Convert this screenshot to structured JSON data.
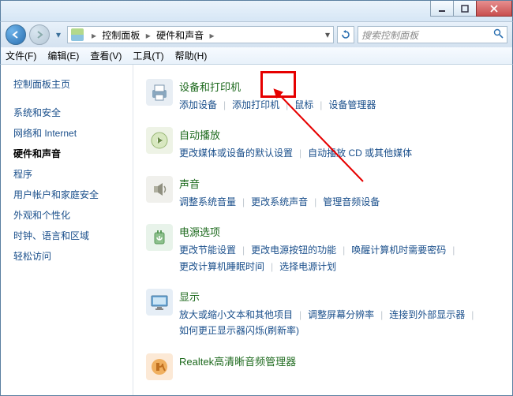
{
  "breadcrumb": {
    "root_icon_name": "control-panel-icon",
    "parts": [
      "控制面板",
      "硬件和声音"
    ]
  },
  "search": {
    "placeholder": "搜索控制面板"
  },
  "menu": {
    "file": "文件(F)",
    "edit": "编辑(E)",
    "view": "查看(V)",
    "tools": "工具(T)",
    "help": "帮助(H)"
  },
  "sidebar": {
    "items": [
      {
        "label": "控制面板主页"
      },
      {
        "label": "系统和安全"
      },
      {
        "label": "网络和 Internet"
      },
      {
        "label": "硬件和声音",
        "active": true
      },
      {
        "label": "程序"
      },
      {
        "label": "用户帐户和家庭安全"
      },
      {
        "label": "外观和个性化"
      },
      {
        "label": "时钟、语言和区域"
      },
      {
        "label": "轻松访问"
      }
    ]
  },
  "sections": [
    {
      "id": "devices",
      "title": "设备和打印机",
      "icon": "printer-icon",
      "icon_bg": "#e8eef4",
      "links": [
        "添加设备",
        "添加打印机",
        "鼠标",
        "设备管理器"
      ]
    },
    {
      "id": "autoplay",
      "title": "自动播放",
      "icon": "autoplay-icon",
      "icon_bg": "#eef3e6",
      "links": [
        "更改媒体或设备的默认设置",
        "自动播放 CD 或其他媒体"
      ]
    },
    {
      "id": "sound",
      "title": "声音",
      "icon": "speaker-icon",
      "icon_bg": "#f0f0ec",
      "links": [
        "调整系统音量",
        "更改系统声音",
        "管理音频设备"
      ]
    },
    {
      "id": "power",
      "title": "电源选项",
      "icon": "power-icon",
      "icon_bg": "#e8f3ea",
      "links": [
        "更改节能设置",
        "更改电源按钮的功能",
        "唤醒计算机时需要密码",
        "更改计算机睡眠时间",
        "选择电源计划"
      ]
    },
    {
      "id": "display",
      "title": "显示",
      "icon": "monitor-icon",
      "icon_bg": "#e6eef6",
      "links": [
        "放大或缩小文本和其他项目",
        "调整屏幕分辨率",
        "连接到外部显示器",
        "如何更正显示器闪烁(刷新率)"
      ]
    },
    {
      "id": "realtek",
      "title": "Realtek高清晰音频管理器",
      "icon": "realtek-icon",
      "icon_bg": "#fce9d6",
      "links": []
    }
  ],
  "highlight": {
    "target_link": "鼠标"
  }
}
